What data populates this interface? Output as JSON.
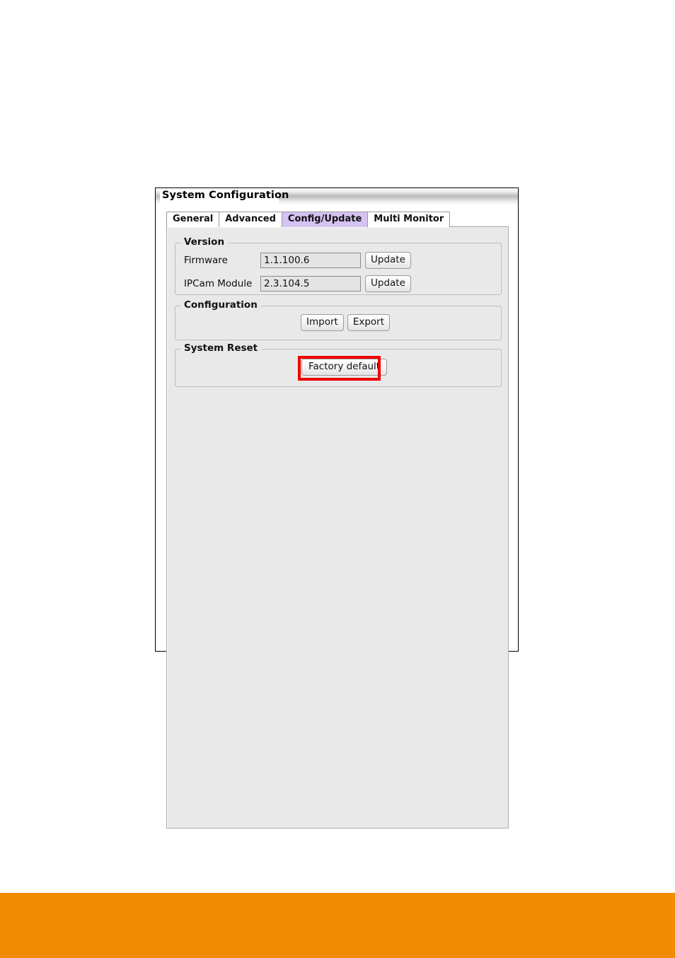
{
  "window": {
    "title": "System Configuration"
  },
  "tabs": [
    {
      "label": "General",
      "active": false
    },
    {
      "label": "Advanced",
      "active": false
    },
    {
      "label": "Config/Update",
      "active": true
    },
    {
      "label": "Multi Monitor",
      "active": false
    }
  ],
  "groups": {
    "version": {
      "title": "Version",
      "rows": [
        {
          "label": "Firmware",
          "value": "1.1.100.6",
          "button": "Update"
        },
        {
          "label": "IPCam Module",
          "value": "2.3.104.5",
          "button": "Update"
        }
      ]
    },
    "configuration": {
      "title": "Configuration",
      "buttons": [
        {
          "label": "Import"
        },
        {
          "label": "Export"
        }
      ]
    },
    "system_reset": {
      "title": "System Reset",
      "buttons": [
        {
          "label": "Factory default",
          "highlighted": true
        }
      ]
    }
  },
  "colors": {
    "active_tab": "#d6c2f2",
    "panel_background": "#e9e9e9",
    "highlight": "#ee0000",
    "footer": "#f08c00",
    "field_background": "#e4e4e4"
  }
}
